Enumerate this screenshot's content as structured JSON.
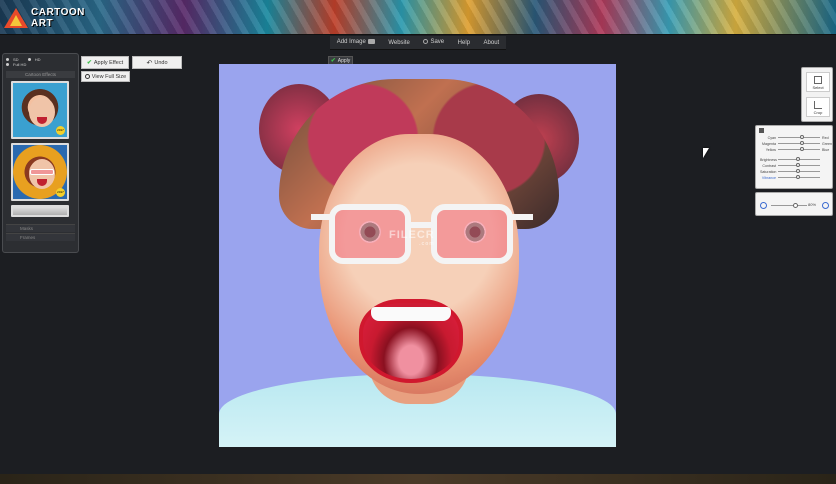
{
  "banner": {
    "logo_text": "CARTOON ART"
  },
  "topmenu": {
    "items": [
      "Add Image",
      "Website",
      "Save",
      "Help",
      "About"
    ]
  },
  "apply_top_label": "Apply",
  "leftpanel": {
    "size_options": [
      "SD",
      "HD",
      "Full HD"
    ],
    "category_label": "Cartoon Effects",
    "sections": [
      "Masks",
      "Frames"
    ],
    "badges": [
      "2017",
      "2017"
    ]
  },
  "buttons": {
    "apply_effect": "Apply Effect",
    "undo": "Undo",
    "view_full_size": "View Full Size"
  },
  "watermark": {
    "text": "FILECR",
    "sub": ".com"
  },
  "tools": {
    "select": "Select",
    "crop": "Crop"
  },
  "adjust": {
    "rows": [
      {
        "left": "Cyan",
        "right": "Red"
      },
      {
        "left": "Magenta",
        "right": "Green"
      },
      {
        "left": "Yellow",
        "right": "Blue"
      },
      {
        "left": "Brightness",
        "right": ""
      },
      {
        "left": "Contrast",
        "right": ""
      },
      {
        "left": "Saturation",
        "right": ""
      },
      {
        "left": "Vibrance",
        "right": ""
      }
    ]
  },
  "zoom": {
    "value": "80%"
  }
}
